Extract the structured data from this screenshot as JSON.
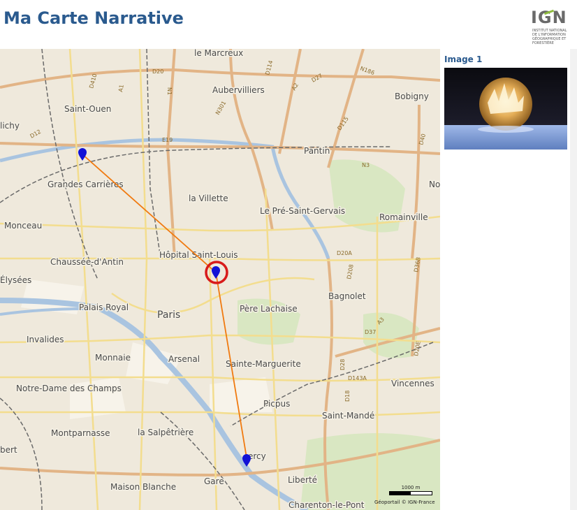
{
  "app": {
    "title": "Ma Carte Narrative"
  },
  "logo": {
    "word": "IGN",
    "tagline": "Institut national de l'information géographique et forestière"
  },
  "map": {
    "places": [
      "le Marcreux",
      "Aubervilliers",
      "Saint-Ouen",
      "Bobigny",
      "lichy",
      "Pantin",
      "Grandes Carrières",
      "No",
      "la Villette",
      "Le Pré-Saint-Gervais",
      "Romainville",
      "Monceau",
      "Hôpital Saint-Louis",
      "Chaussée-d'Antin",
      "Élysées",
      "Bagnolet",
      "Palais Royal",
      "Père Lachaise",
      "Paris",
      "Invalides",
      "Monnaie",
      "Arsenal",
      "Sainte-Marguerite",
      "Notre-Dame des Champs",
      "Vincennes",
      "Picpus",
      "Saint-Mandé",
      "Montparnasse",
      "la Salpêtrière",
      "ercy",
      "bert",
      "Liberté",
      "Maison Blanche",
      "Gare",
      "Charenton-le-Pont"
    ],
    "road_labels": [
      "D20",
      "D114",
      "D27",
      "N186",
      "D410",
      "A1",
      "N1",
      "E19",
      "N301",
      "A2",
      "D115",
      "D12",
      "D40",
      "N3",
      "D20A",
      "D208",
      "A3",
      "D36B",
      "D37",
      "D20E",
      "D28",
      "D143A",
      "D18"
    ],
    "scale": {
      "label": "1000 m"
    },
    "attribution": "Géoportail © IGN-France",
    "markers": [
      {
        "name": "marker-1",
        "selected": false
      },
      {
        "name": "marker-2",
        "selected": true
      },
      {
        "name": "marker-3",
        "selected": false
      }
    ],
    "colors": {
      "route": "#f07a10",
      "marker": "#1212d6",
      "selection": "#d81b1b",
      "water": "#a9c4e0"
    }
  },
  "panel": {
    "title": "Image 1",
    "image": "frozen-bubble-photo"
  }
}
